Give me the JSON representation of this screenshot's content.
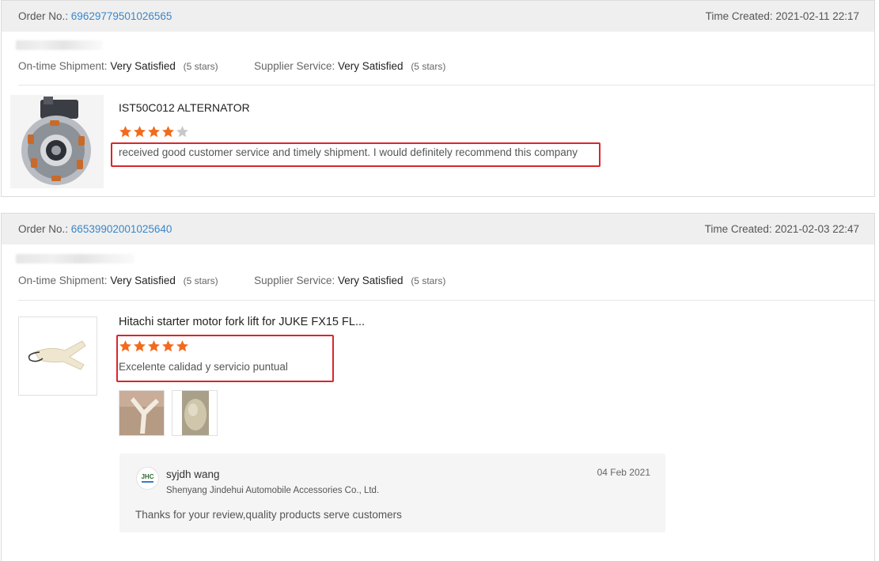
{
  "orders": [
    {
      "order_label": "Order No.:",
      "order_number": "69629779501026565",
      "time_label": "Time Created:",
      "time_value": "2021-02-11 22:17",
      "shipment_label": "On-time Shipment:",
      "shipment_value": "Very Satisfied",
      "shipment_stars": "(5 stars)",
      "service_label": "Supplier Service:",
      "service_value": "Very Satisfied",
      "service_stars": "(5 stars)",
      "product_title": "IST50C012 ALTERNATOR",
      "rating": 4,
      "review_text": "received good customer service and timely shipment. I would definitely recommend this company"
    },
    {
      "order_label": "Order No.:",
      "order_number": "66539902001025640",
      "time_label": "Time Created:",
      "time_value": "2021-02-03 22:47",
      "shipment_label": "On-time Shipment:",
      "shipment_value": "Very Satisfied",
      "shipment_stars": "(5 stars)",
      "service_label": "Supplier Service:",
      "service_value": "Very Satisfied",
      "service_stars": "(5 stars)",
      "product_title": "Hitachi starter motor fork lift for JUKE FX15 FL...",
      "rating": 5,
      "review_text": "Excelente calidad y servicio puntual",
      "reply": {
        "name": "syjdh wang",
        "company": "Shenyang Jindehui Automobile Accessories Co., Ltd.",
        "date": "04 Feb 2021",
        "text": "Thanks for your review,quality products serve customers"
      }
    }
  ],
  "colors": {
    "star_on": "#f26b1d",
    "star_off": "#c8c8c8",
    "link": "#3a87c9",
    "highlight": "#d9262c"
  },
  "icons": {
    "star": "star-icon",
    "logo": "supplier-logo-icon"
  }
}
